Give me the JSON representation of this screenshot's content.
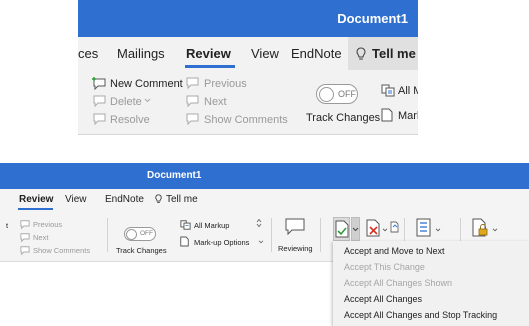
{
  "top": {
    "title": "Document1",
    "tabs": [
      "ces",
      "Mailings",
      "Review",
      "View",
      "EndNote",
      "Tell me"
    ],
    "active_tab": "Review",
    "commands": {
      "new_comment": "New Comment",
      "delete": "Delete",
      "resolve": "Resolve",
      "previous": "Previous",
      "next": "Next",
      "show_comments": "Show Comments",
      "toggle": "OFF",
      "track_changes": "Track Changes",
      "all_markup_partial": "All M",
      "markup_partial": "Mark"
    }
  },
  "bottom": {
    "title": "Document1",
    "tabs": [
      "Review",
      "View",
      "EndNote",
      "Tell me"
    ],
    "active_tab": "Review",
    "commands": {
      "t_partial": "t",
      "previous": "Previous",
      "next": "Next",
      "show_comments": "Show Comments",
      "toggle": "OFF",
      "track_changes": "Track Changes",
      "all_markup": "All Markup",
      "markup_options": "Mark-up Options",
      "reviewing": "Reviewing"
    }
  },
  "accept_menu": {
    "items": [
      {
        "label": "Accept and Move to Next",
        "enabled": true
      },
      {
        "label": "Accept This Change",
        "enabled": false
      },
      {
        "label": "Accept All Changes Shown",
        "enabled": false
      },
      {
        "label": "Accept All Changes",
        "enabled": true
      },
      {
        "label": "Accept All Changes and Stop Tracking",
        "enabled": true
      }
    ]
  },
  "colors": {
    "title_bar": "#2f6fcf",
    "ribbon_bg": "#f2f2f2",
    "disabled_text": "#9a9a9a",
    "reject_red": "#d93025",
    "accept_green": "#2e9b3a"
  }
}
